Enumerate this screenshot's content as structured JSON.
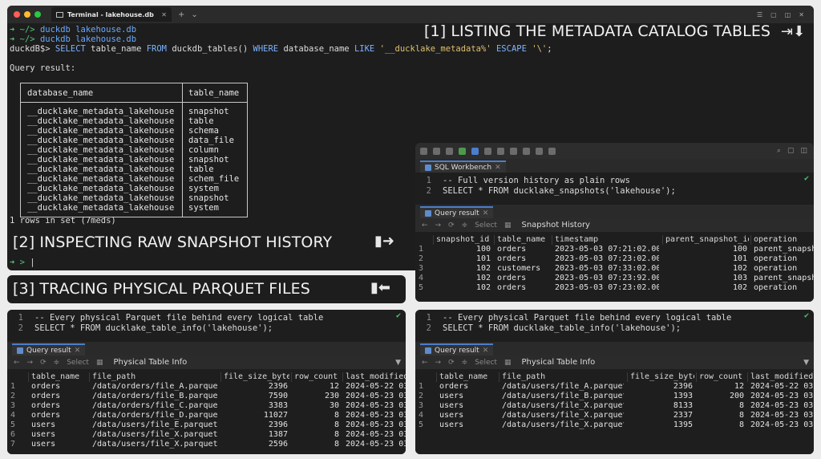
{
  "terminal": {
    "tab_title": "Terminal - lakehouse.db",
    "lines": [
      {
        "prompt": "➜ ~/>",
        "cmd": "duckdb lakehouse.db"
      },
      {
        "prompt": "➜ ~/>",
        "cmd": "duckdb lakehouse.db"
      }
    ],
    "sql_prompt": "duckdB$>",
    "sql_parts": {
      "select": "SELECT",
      "col": "table_name",
      "from": "FROM",
      "fn": "duckdb_tables()",
      "where": "WHERE",
      "col2": "database_name",
      "like": "LIKE",
      "pattern": "'__ducklake_metadata%'",
      "escape": "ESCAPE",
      "esc_char": "'\\'",
      "end": ";"
    },
    "query_result_label": "Query result:",
    "table": {
      "columns": [
        "database_name",
        "table_name"
      ],
      "rows": [
        [
          "__ducklake_metadata_lakehouse",
          "snapshot"
        ],
        [
          "__ducklake_metadata_lakehouse",
          "table"
        ],
        [
          "__ducklake_metadata_lakehouse",
          "schema"
        ],
        [
          "__ducklake_metadata_lakehouse",
          "data_file"
        ],
        [
          "__ducklake_metadata_lakehouse",
          "column"
        ],
        [
          "__ducklake_metadata_lakehouse",
          "snapshot"
        ],
        [
          "__ducklake_metadata_lakehouse",
          "table"
        ],
        [
          "__ducklake_metadata_lakehouse",
          "schem_file"
        ],
        [
          "__ducklake_metadata_lakehouse",
          "system"
        ],
        [
          "__ducklake_metadata_lakehouse",
          "snapshot"
        ],
        [
          "__ducklake_metadata_lakehouse",
          "system"
        ]
      ]
    },
    "rows_in_set": "1 rows in set (7meds)",
    "final_prompt": "➜ >"
  },
  "headings": {
    "h1": "[1] LISTING THE METADATA CATALOG TABLES",
    "h2": "[2]  INSPECTING RAW SNAPSHOT HISTORY",
    "h3": "[3]  TRACING PHYSICAL PARQUET FILES"
  },
  "snapshot_window": {
    "tab_label": "SQL Workbench",
    "code": [
      {
        "ln": "1",
        "text": "-- Full version history as plain rows"
      },
      {
        "ln": "2",
        "text": "SELECT * FROM ducklake_snapshots('lakehouse');"
      }
    ],
    "result_tab": "Query result",
    "grid_select": "Select",
    "grid_title": "Snapshot History",
    "columns": [
      "snapshot_id",
      "table_name",
      "timestamp",
      "parent_snapshot_id",
      "operation"
    ],
    "rows": [
      [
        "1",
        "100",
        "orders",
        "2023-05-03 07:21:02.000",
        "100",
        "parent_snapshot"
      ],
      [
        "2",
        "101",
        "orders",
        "2023-05-03 07:23:02.000",
        "101",
        "operation"
      ],
      [
        "3",
        "102",
        "customers",
        "2023-05-03 07:33:02.000",
        "102",
        "operation"
      ],
      [
        "4",
        "102",
        "orders",
        "2023-05-03 07:23:92.000",
        "103",
        "parent_snapshot"
      ],
      [
        "5",
        "102",
        "orders",
        "2023-05-03 07:23:02.000",
        "102",
        "operation"
      ]
    ]
  },
  "left_window": {
    "code": [
      {
        "ln": "1",
        "text": "-- Every physical Parquet file behind every logical table"
      },
      {
        "ln": "2",
        "text": "SELECT * FROM ducklake_table_info('lakehouse');"
      }
    ],
    "result_tab": "Query result",
    "grid_select": "Select",
    "grid_title": "Physical Table Info",
    "columns": [
      "table_name",
      "file_path",
      "file_size_bytes",
      "row_count",
      "last_modified"
    ],
    "rows": [
      [
        "1",
        "orders",
        "/data/orders/file_A.parquet",
        "2396",
        "12",
        "2024-05-22 03"
      ],
      [
        "2",
        "orders",
        "/data/orders/file_B.parquet",
        "7590",
        "230",
        "2024-05-23 03"
      ],
      [
        "3",
        "orders",
        "/data/orders/file_C.parquet",
        "3383",
        "30",
        "2024-05-23 03"
      ],
      [
        "4",
        "orders",
        "/data/orders/file_D.parquet",
        "11027",
        "8",
        "2024-05-23 03"
      ],
      [
        "5",
        "users",
        "/data/users/file_E.parquet",
        "2396",
        "8",
        "2024-05-23 03"
      ],
      [
        "6",
        "users",
        "/data/users/file_X.parquet",
        "1387",
        "8",
        "2024-05-23 03"
      ],
      [
        "7",
        "users",
        "/data/users/file_X.parquet",
        "2596",
        "8",
        "2024-05-23 03"
      ]
    ]
  },
  "right_window": {
    "code": [
      {
        "ln": "1",
        "text": "-- Every physical Parquet file behind every logical table"
      },
      {
        "ln": "2",
        "text": "SELECT * FROM ducklake_table_info('lakehouse');"
      }
    ],
    "result_tab": "Query result",
    "grid_select": "Select",
    "grid_title": "Physical Table Info",
    "columns": [
      "table_name",
      "file_path",
      "file_size_bytes",
      "row_count",
      "last_modified"
    ],
    "rows": [
      [
        "1",
        "orders",
        "/data/users/file_A.parquet",
        "2396",
        "12",
        "2024-05-22 03"
      ],
      [
        "2",
        "users",
        "/data/users/file_B.parquet",
        "1393",
        "200",
        "2024-05-23 03"
      ],
      [
        "3",
        "users",
        "/data/users/file_X.parquet",
        "8133",
        "8",
        "2024-05-23 03"
      ],
      [
        "4",
        "users",
        "/data/users/file_X.parquet",
        "2337",
        "8",
        "2024-05-23 03"
      ],
      [
        "5",
        "users",
        "/data/users/file_X.parquet",
        "1395",
        "8",
        "2024-05-23 03"
      ]
    ]
  },
  "colors": {
    "accent_blue": "#4b7ecb",
    "prompt_green": "#55c47c",
    "keyword": "#7cb3ff"
  }
}
